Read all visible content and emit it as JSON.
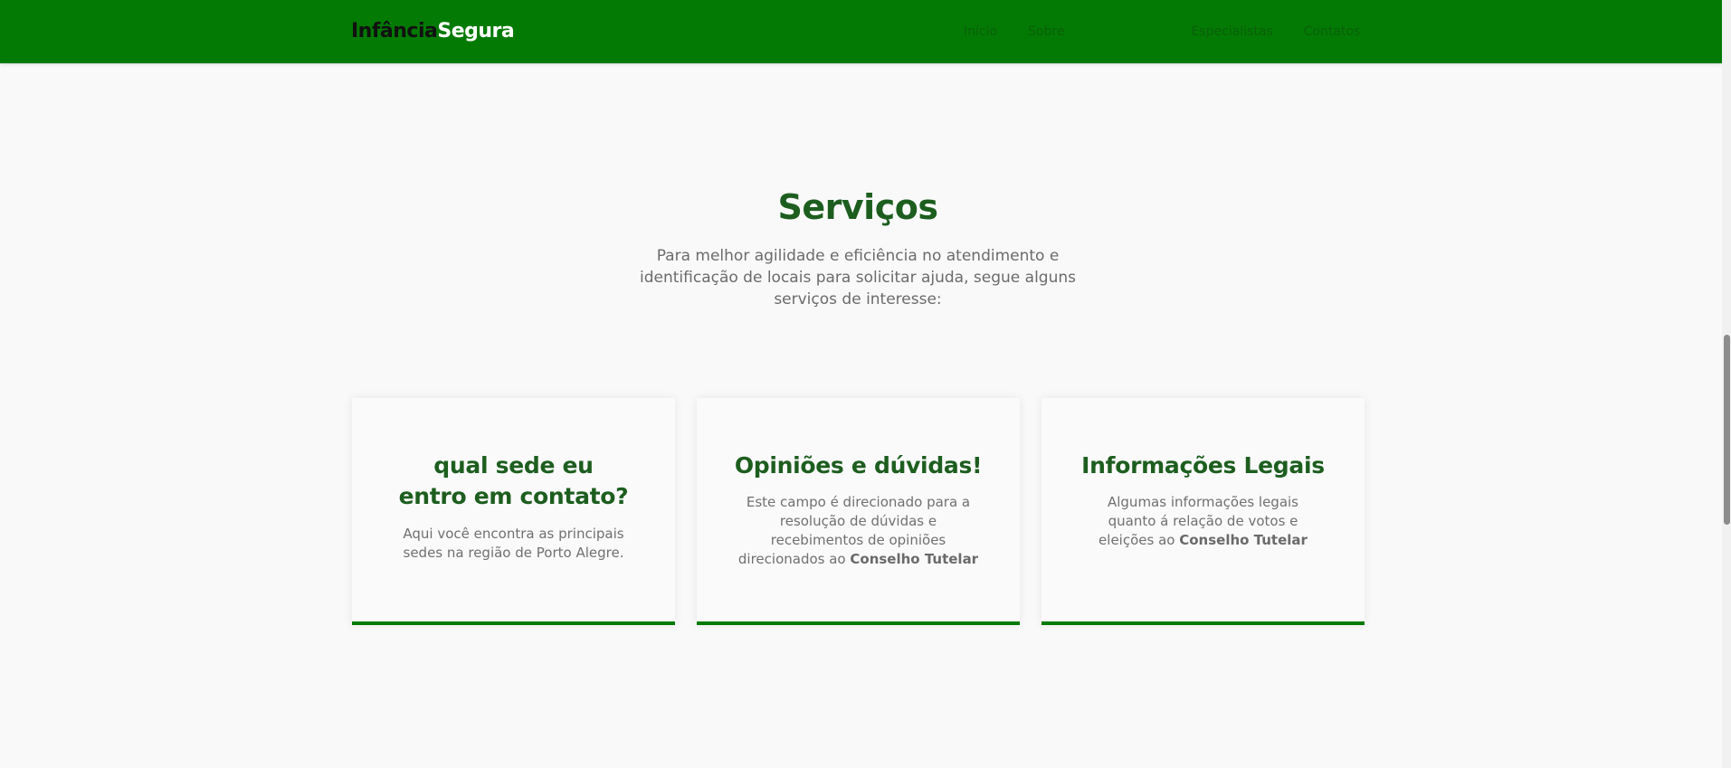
{
  "header": {
    "logo_part1": "Infância",
    "logo_part2": "Segura",
    "nav": [
      "Início",
      "Sobre",
      "Especialistas",
      "Contatos"
    ]
  },
  "services": {
    "title": "Serviços",
    "subtitle": "Para melhor agilidade e eficiência no atendimento e identificação de locais para solicitar ajuda, segue alguns serviços de interesse:"
  },
  "cards": [
    {
      "title": "qual sede eu entro em contato?",
      "text": "Aqui você encontra as principais sedes na região de Porto Alegre.",
      "text_bold": ""
    },
    {
      "title": "Opiniões e dúvidas!",
      "text": "Este campo é direcionado para a resolução de dúvidas e recebimentos de opiniões direcionados ao ",
      "text_bold": "Conselho Tutelar"
    },
    {
      "title": "Informações Legais",
      "text": "Algumas informações legais quanto á relação de votos e eleições ao ",
      "text_bold": "Conselho Tutelar"
    }
  ],
  "colors": {
    "header_bg": "#037a03",
    "accent": "#1d5e1f",
    "page_bg": "#f9f9fa"
  }
}
